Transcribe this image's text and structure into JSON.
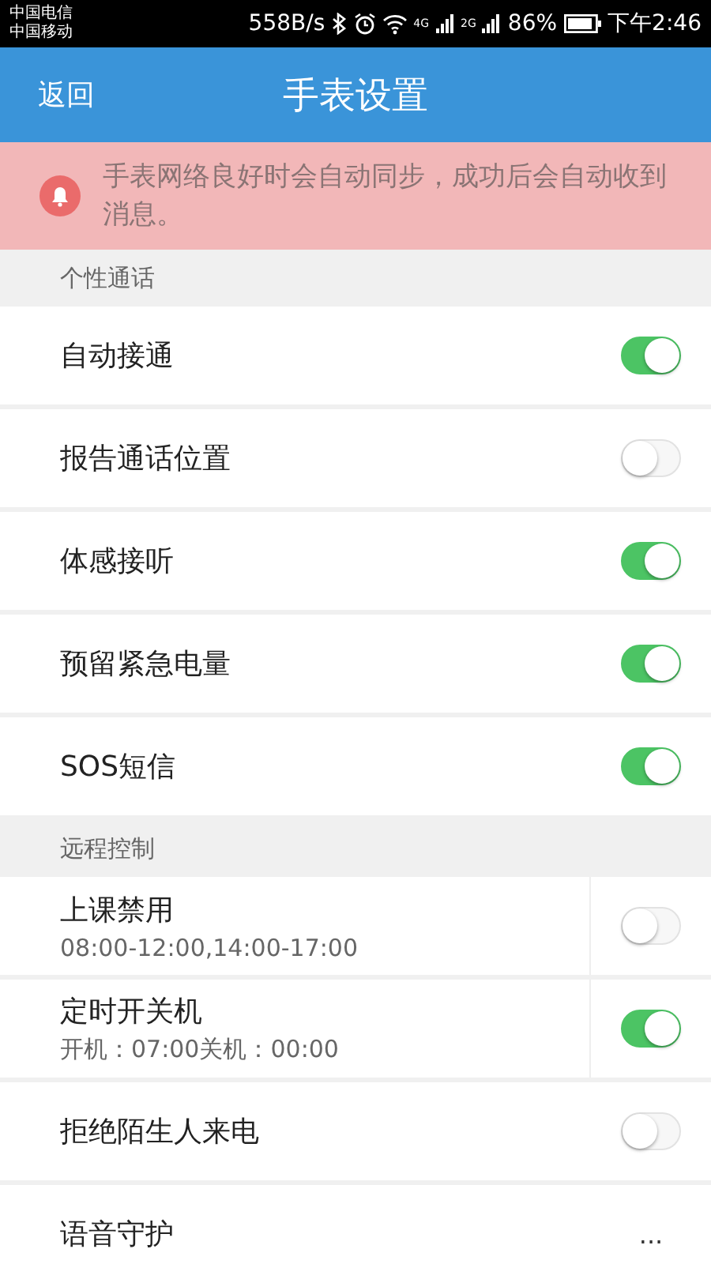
{
  "status_bar": {
    "carriers": [
      "中国电信",
      "中国移动"
    ],
    "speed": "558B/s",
    "network_a": "4G",
    "network_b": "2G",
    "battery": "86%",
    "time": "下午2:46"
  },
  "header": {
    "back": "返回",
    "title": "手表设置"
  },
  "notice": {
    "text": "手表网络良好时会自动同步，成功后会自动收到消息。"
  },
  "sections": [
    {
      "title": "个性通话",
      "items": [
        {
          "kind": "toggle",
          "label": "自动接通",
          "on": true
        },
        {
          "kind": "toggle",
          "label": "报告通话位置",
          "on": false
        },
        {
          "kind": "toggle",
          "label": "体感接听",
          "on": true
        },
        {
          "kind": "toggle",
          "label": "预留紧急电量",
          "on": true
        },
        {
          "kind": "toggle",
          "label": "SOS短信",
          "on": true
        }
      ]
    },
    {
      "title": "远程控制",
      "items": [
        {
          "kind": "toggle",
          "label": "上课禁用",
          "detail": "08:00-12:00,14:00-17:00",
          "on": false
        },
        {
          "kind": "toggle",
          "label": "定时开关机",
          "detail": "开机：07:00关机：00:00",
          "on": true
        },
        {
          "kind": "toggle",
          "label": "拒绝陌生人来电",
          "on": false
        },
        {
          "kind": "more",
          "label": "语音守护",
          "more": "..."
        }
      ]
    }
  ]
}
